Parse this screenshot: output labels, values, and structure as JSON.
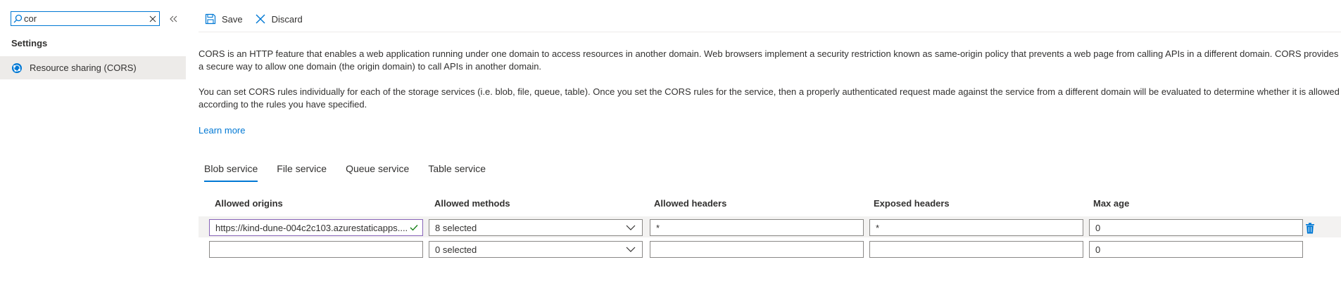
{
  "colors": {
    "accent": "#0078d4",
    "selected_nav_bg": "#edebe9",
    "focused_input_border": "#8764b8",
    "check_green": "#107c10",
    "text": "#323130"
  },
  "sidebar": {
    "search": {
      "value": "cor",
      "icon": "search-icon",
      "clear_icon": "close-icon"
    },
    "collapse_icon": "double-chevron-left-icon",
    "group_title": "Settings",
    "items": [
      {
        "label": "Resource sharing (CORS)",
        "icon": "cors-globe-icon",
        "selected": true
      }
    ]
  },
  "toolbar": {
    "save_label": "Save",
    "discard_label": "Discard"
  },
  "description": {
    "p1": "CORS is an HTTP feature that enables a web application running under one domain to access resources in another domain. Web browsers implement a security restriction known as same-origin policy that prevents a web page from calling APIs in a different domain. CORS provides a secure way to allow one domain (the origin domain) to call APIs in another domain.",
    "p2": "You can set CORS rules individually for each of the storage services (i.e. blob, file, queue, table). Once you set the CORS rules for the service, then a properly authenticated request made against the service from a different domain will be evaluated to determine whether it is allowed according to the rules you have specified.",
    "learn_more": "Learn more"
  },
  "tabs": [
    {
      "label": "Blob service",
      "active": true
    },
    {
      "label": "File service",
      "active": false
    },
    {
      "label": "Queue service",
      "active": false
    },
    {
      "label": "Table service",
      "active": false
    }
  ],
  "table": {
    "columns": [
      "Allowed origins",
      "Allowed methods",
      "Allowed headers",
      "Exposed headers",
      "Max age"
    ],
    "rows": [
      {
        "allowed_origins": "https://kind-dune-004c2c103.azurestaticapps....",
        "allowed_methods": "8 selected",
        "allowed_headers": "*",
        "exposed_headers": "*",
        "max_age": "0"
      },
      {
        "allowed_origins": "",
        "allowed_methods": "0 selected",
        "allowed_headers": "",
        "exposed_headers": "",
        "max_age": "0"
      }
    ]
  }
}
